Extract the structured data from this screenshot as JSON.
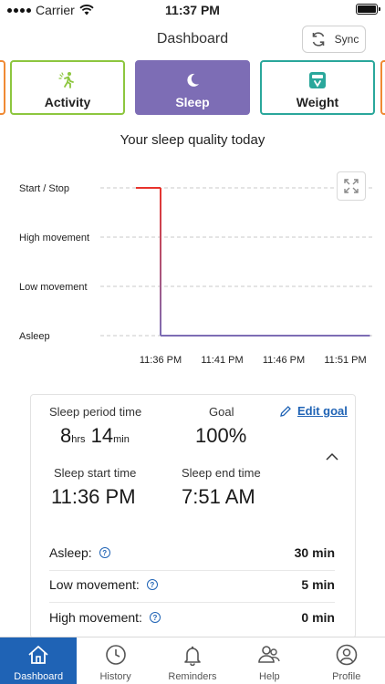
{
  "status_bar": {
    "carrier": "Carrier",
    "time": "11:37 PM"
  },
  "header": {
    "title": "Dashboard",
    "sync_label": "Sync"
  },
  "tabs": [
    {
      "label": "Activity",
      "color": "#8dc63f",
      "icon": "running-figure-icon"
    },
    {
      "label": "Sleep",
      "color": "#7d6db5",
      "icon": "moon-icon",
      "selected": true
    },
    {
      "label": "Weight",
      "color": "#2aa79b",
      "icon": "scale-icon"
    }
  ],
  "chart_heading": "Your sleep quality today",
  "chart_data": {
    "type": "line",
    "y_categories": [
      "Start / Stop",
      "High movement",
      "Low movement",
      "Asleep"
    ],
    "x_ticks": [
      "11:36 PM",
      "11:41 PM",
      "11:46 PM",
      "11:51 PM"
    ],
    "x_range_minutes": [
      0,
      20
    ],
    "series": [
      {
        "points": [
          {
            "x": "11:34 PM",
            "y": "Start / Stop"
          },
          {
            "x": "11:36 PM",
            "y": "Start / Stop"
          },
          {
            "x": "11:36 PM",
            "y": "Asleep"
          },
          {
            "x": "11:53 PM",
            "y": "Asleep"
          }
        ],
        "color_start": "#e8332c",
        "color_end": "#7d6db5"
      }
    ],
    "grid": "horizontal-dashed"
  },
  "summary": {
    "sleep_period_label": "Sleep period time",
    "sleep_period_hours": "8",
    "hours_unit": "hrs",
    "sleep_period_minutes": "14",
    "minutes_unit": "min",
    "goal_label": "Goal",
    "goal_value": "100%",
    "edit_goal_label": "Edit goal",
    "start_label": "Sleep start time",
    "start_value": "11:36 PM",
    "end_label": "Sleep end time",
    "end_value": "7:51 AM",
    "rows": [
      {
        "label": "Asleep:",
        "value": "30 min"
      },
      {
        "label": "Low movement:",
        "value": "5 min"
      },
      {
        "label": "High movement:",
        "value": "0 min"
      }
    ]
  },
  "tabbar": [
    {
      "label": "Dashboard",
      "icon": "home-icon",
      "active": true
    },
    {
      "label": "History",
      "icon": "clock-icon"
    },
    {
      "label": "Reminders",
      "icon": "bell-icon"
    },
    {
      "label": "Help",
      "icon": "help-people-icon"
    },
    {
      "label": "Profile",
      "icon": "profile-icon"
    }
  ],
  "colors": {
    "accent": "#1f63b5",
    "sleep": "#7d6db5",
    "activity": "#8dc63f",
    "weight": "#2aa79b",
    "line_start": "#e8332c"
  }
}
